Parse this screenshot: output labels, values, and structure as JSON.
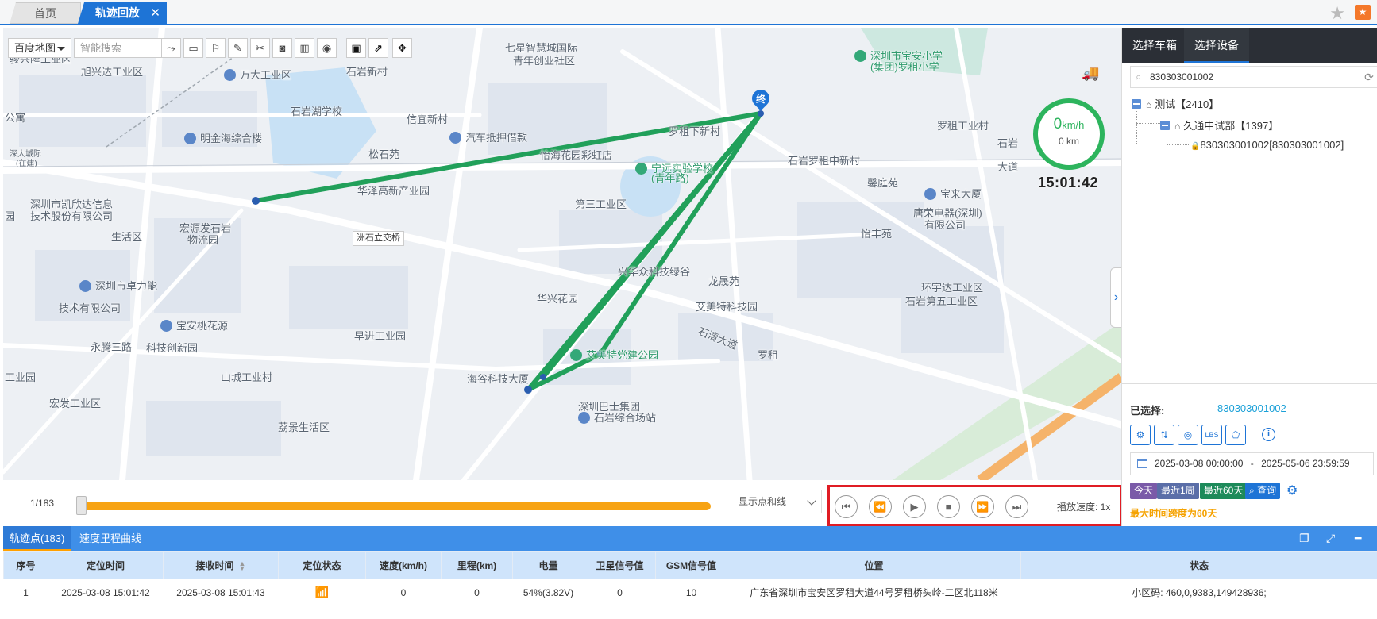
{
  "tabs": {
    "home_label": "首页",
    "track_label": "轨迹回放",
    "close_symbol": "✕"
  },
  "map": {
    "type_label": "百度地图",
    "search_placeholder": "智能搜索",
    "speed_value": "0",
    "speed_unit": "km/h",
    "distance": "0 km",
    "time": "15:01:42",
    "end_marker": "终",
    "labels": [
      {
        "text": "骏兴隆工业区"
      },
      {
        "text": "旭兴达工业区"
      },
      {
        "text": "万大工业区"
      },
      {
        "text": "石岩新村"
      },
      {
        "text": "七星智慧城国际"
      },
      {
        "text": "青年创业社区"
      },
      {
        "text": "深圳市宝安小学"
      },
      {
        "text": "(集团)罗租小学"
      },
      {
        "text": "石岩湖学校"
      },
      {
        "text": "信宜新村"
      },
      {
        "text": "公寓"
      },
      {
        "text": "明金海综合楼"
      },
      {
        "text": "汽车抵押借款"
      },
      {
        "text": "深大城际"
      },
      {
        "text": "(在建)"
      },
      {
        "text": "松石苑"
      },
      {
        "text": "罗租下新村"
      },
      {
        "text": "罗租工业村"
      },
      {
        "text": "怡海花园彩虹店"
      },
      {
        "text": "宁远实验学校"
      },
      {
        "text": "(青年路)"
      },
      {
        "text": "石岩罗租中新村"
      },
      {
        "text": "石岩"
      },
      {
        "text": "大道"
      },
      {
        "text": "华泽高新产业园"
      },
      {
        "text": "馨庭苑"
      },
      {
        "text": "宝来大厦"
      },
      {
        "text": "深圳市凯欣达信息"
      },
      {
        "text": "技术股份有限公司"
      },
      {
        "text": "宏源发石岩"
      },
      {
        "text": "物流园"
      },
      {
        "text": "第三工业区"
      },
      {
        "text": "唐荣电器(深圳)"
      },
      {
        "text": "有限公司"
      },
      {
        "text": "怡丰苑"
      },
      {
        "text": "洲石立交桥"
      },
      {
        "text": "生活区"
      },
      {
        "text": "兴华众科技绿谷"
      },
      {
        "text": "龙晟苑"
      },
      {
        "text": "深圳市卓力能"
      },
      {
        "text": "技术有限公司"
      },
      {
        "text": "华兴花园"
      },
      {
        "text": "艾美特科技园"
      },
      {
        "text": "环宇达工业区"
      },
      {
        "text": "石岩第五工业区"
      },
      {
        "text": "宝安桃花源"
      },
      {
        "text": "科技创新园"
      },
      {
        "text": "石清大道"
      },
      {
        "text": "永腾三路"
      },
      {
        "text": "早进工业园"
      },
      {
        "text": "艾美特党建公园"
      },
      {
        "text": "罗租"
      },
      {
        "text": "山城工业村"
      },
      {
        "text": "海谷科技大厦"
      },
      {
        "text": "深圳巴士集团"
      },
      {
        "text": "石岩综合场站"
      },
      {
        "text": "宏发工业区"
      },
      {
        "text": "荔景生活区"
      },
      {
        "text": "园"
      },
      {
        "text": "工业园"
      }
    ]
  },
  "playback": {
    "count": "1/183",
    "progress": 0.005,
    "display_mode": "显示点和线",
    "speed_label": "播放速度: 1x"
  },
  "right_panel": {
    "tab_vehicle": "选择车箱",
    "tab_device": "选择设备",
    "search_value": "830303001002",
    "tree": {
      "root": "测试【2410】",
      "child": "久通中试部【1397】",
      "leaf": "830303001002[830303001002]"
    },
    "selected_label": "已选择:",
    "selected_value": "830303001002",
    "lbs_label": "LBS",
    "date_start": "2025-03-08 00:00:00",
    "date_sep": "-",
    "date_end": "2025-05-06 23:59:59",
    "btn_today": "今天",
    "btn_week": "最近1周",
    "btn_60": "最近60天",
    "btn_query": "查询",
    "max_span": "最大时间跨度为60天"
  },
  "table": {
    "tab_points": "轨迹点(183)",
    "tab_curve": "速度里程曲线",
    "headers": [
      "序号",
      "定位时间",
      "接收时间",
      "定位状态",
      "速度(km/h)",
      "里程(km)",
      "电量",
      "卫星信号值",
      "GSM信号值",
      "位置",
      "状态"
    ],
    "rows": [
      [
        "1",
        "2025-03-08 15:01:42",
        "2025-03-08 15:01:43",
        "",
        "0",
        "0",
        "54%(3.82V)",
        "0",
        "10",
        "广东省深圳市宝安区罗租大道44号罗租桥头岭-二区北118米",
        "小区码: 460,0,9383,149428936;"
      ]
    ]
  },
  "colors": {
    "accent": "#1e74d6",
    "track": "#21a05a",
    "progress": "#f7a313",
    "highlight_box": "#e01c24"
  }
}
